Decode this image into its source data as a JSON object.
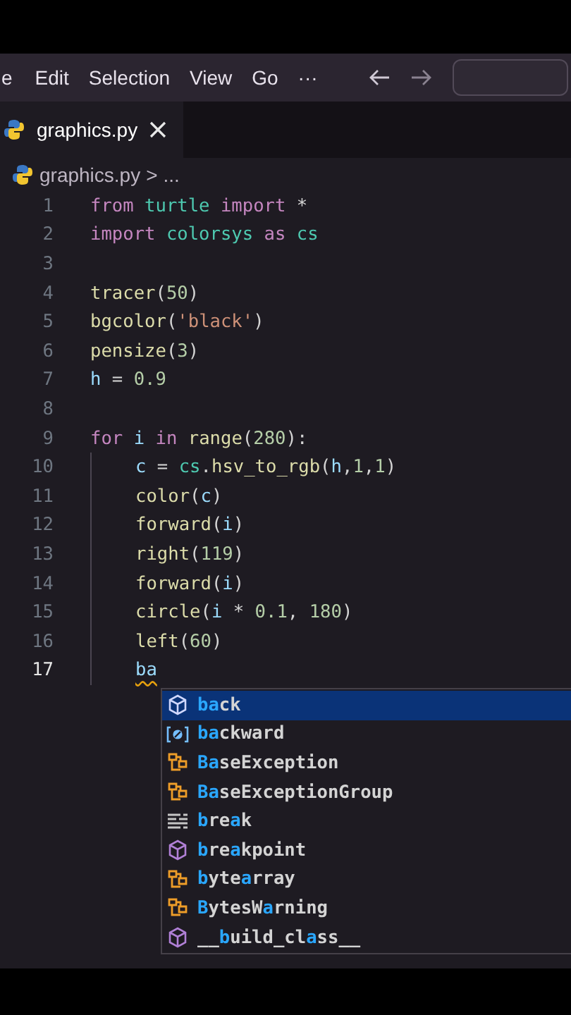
{
  "menu": [
    "e",
    "Edit",
    "Selection",
    "View",
    "Go",
    "···"
  ],
  "tabs": [
    {
      "label": "graphics.py",
      "selected": true
    }
  ],
  "breadcrumb": {
    "file": "graphics.py",
    "separator": ">",
    "rest": "..."
  },
  "code": [
    {
      "number": "1",
      "current": false,
      "indent": false,
      "tokens": [
        {
          "text": "from ",
          "kind": "keyword"
        },
        {
          "text": "turtle ",
          "kind": "module"
        },
        {
          "text": "import ",
          "kind": "keyword"
        },
        {
          "text": "*",
          "kind": "plain"
        }
      ]
    },
    {
      "number": "2",
      "current": false,
      "indent": false,
      "tokens": [
        {
          "text": "import ",
          "kind": "keyword"
        },
        {
          "text": "colorsys ",
          "kind": "module"
        },
        {
          "text": "as ",
          "kind": "keyword"
        },
        {
          "text": "cs",
          "kind": "module"
        }
      ]
    },
    {
      "number": "3",
      "current": false,
      "indent": false
    },
    {
      "number": "4",
      "current": false,
      "indent": false,
      "tokens": [
        {
          "text": "tracer",
          "kind": "func"
        },
        {
          "text": "(",
          "kind": "plain"
        },
        {
          "text": "50",
          "kind": "number"
        },
        {
          "text": ")",
          "kind": "plain"
        }
      ]
    },
    {
      "number": "5",
      "current": false,
      "indent": false,
      "tokens": [
        {
          "text": "bgcolor",
          "kind": "func"
        },
        {
          "text": "(",
          "kind": "plain"
        },
        {
          "text": "'black'",
          "kind": "string"
        },
        {
          "text": ")",
          "kind": "plain"
        }
      ]
    },
    {
      "number": "6",
      "current": false,
      "indent": false,
      "tokens": [
        {
          "text": "pensize",
          "kind": "func"
        },
        {
          "text": "(",
          "kind": "plain"
        },
        {
          "text": "3",
          "kind": "number"
        },
        {
          "text": ")",
          "kind": "plain"
        }
      ]
    },
    {
      "number": "7",
      "current": false,
      "indent": false,
      "tokens": [
        {
          "text": "h",
          "kind": "var"
        },
        {
          "text": " = ",
          "kind": "plain"
        },
        {
          "text": "0.9",
          "kind": "number"
        }
      ]
    },
    {
      "number": "8",
      "current": false,
      "indent": false
    },
    {
      "number": "9",
      "current": false,
      "indent": false,
      "tokens": [
        {
          "text": "for ",
          "kind": "keyword"
        },
        {
          "text": "i ",
          "kind": "var"
        },
        {
          "text": "in ",
          "kind": "keyword"
        },
        {
          "text": "range",
          "kind": "func"
        },
        {
          "text": "(",
          "kind": "plain"
        },
        {
          "text": "280",
          "kind": "number"
        },
        {
          "text": "):",
          "kind": "plain"
        }
      ]
    },
    {
      "number": "10",
      "current": false,
      "indent": true,
      "tokens": [
        {
          "text": "c",
          "kind": "var"
        },
        {
          "text": " = ",
          "kind": "plain"
        },
        {
          "text": "cs",
          "kind": "module"
        },
        {
          "text": ".",
          "kind": "plain"
        },
        {
          "text": "hsv_to_rgb",
          "kind": "func"
        },
        {
          "text": "(",
          "kind": "plain"
        },
        {
          "text": "h",
          "kind": "var"
        },
        {
          "text": ",",
          "kind": "plain"
        },
        {
          "text": "1",
          "kind": "number"
        },
        {
          "text": ",",
          "kind": "plain"
        },
        {
          "text": "1",
          "kind": "number"
        },
        {
          "text": ")",
          "kind": "plain"
        }
      ]
    },
    {
      "number": "11",
      "current": false,
      "indent": true,
      "tokens": [
        {
          "text": "color",
          "kind": "func"
        },
        {
          "text": "(",
          "kind": "plain"
        },
        {
          "text": "c",
          "kind": "var"
        },
        {
          "text": ")",
          "kind": "plain"
        }
      ]
    },
    {
      "number": "12",
      "current": false,
      "indent": true,
      "tokens": [
        {
          "text": "forward",
          "kind": "func"
        },
        {
          "text": "(",
          "kind": "plain"
        },
        {
          "text": "i",
          "kind": "var"
        },
        {
          "text": ")",
          "kind": "plain"
        }
      ]
    },
    {
      "number": "13",
      "current": false,
      "indent": true,
      "tokens": [
        {
          "text": "right",
          "kind": "func"
        },
        {
          "text": "(",
          "kind": "plain"
        },
        {
          "text": "119",
          "kind": "number"
        },
        {
          "text": ")",
          "kind": "plain"
        }
      ]
    },
    {
      "number": "14",
      "current": false,
      "indent": true,
      "tokens": [
        {
          "text": "forward",
          "kind": "func"
        },
        {
          "text": "(",
          "kind": "plain"
        },
        {
          "text": "i",
          "kind": "var"
        },
        {
          "text": ")",
          "kind": "plain"
        }
      ]
    },
    {
      "number": "15",
      "current": false,
      "indent": true,
      "tokens": [
        {
          "text": "circle",
          "kind": "func"
        },
        {
          "text": "(",
          "kind": "plain"
        },
        {
          "text": "i",
          "kind": "var"
        },
        {
          "text": " * ",
          "kind": "plain"
        },
        {
          "text": "0.1",
          "kind": "number"
        },
        {
          "text": ", ",
          "kind": "plain"
        },
        {
          "text": "180",
          "kind": "number"
        },
        {
          "text": ")",
          "kind": "plain"
        }
      ]
    },
    {
      "number": "16",
      "current": false,
      "indent": true,
      "tokens": [
        {
          "text": "left",
          "kind": "func"
        },
        {
          "text": "(",
          "kind": "plain"
        },
        {
          "text": "60",
          "kind": "number"
        },
        {
          "text": ")",
          "kind": "plain"
        }
      ]
    },
    {
      "number": "17",
      "current": true,
      "indent": true,
      "tokens": [
        {
          "text": "ba",
          "kind": "error"
        }
      ]
    }
  ],
  "suggestions": [
    {
      "kind": "method",
      "selected": true,
      "parts": [
        {
          "text": "ba",
          "match": true
        },
        {
          "text": "ck",
          "match": false
        }
      ]
    },
    {
      "kind": "variable",
      "selected": false,
      "parts": [
        {
          "text": "ba",
          "match": true
        },
        {
          "text": "ckward",
          "match": false
        }
      ]
    },
    {
      "kind": "class",
      "selected": false,
      "parts": [
        {
          "text": "Ba",
          "match": true
        },
        {
          "text": "seException",
          "match": false
        }
      ]
    },
    {
      "kind": "class",
      "selected": false,
      "parts": [
        {
          "text": "Ba",
          "match": true
        },
        {
          "text": "seExceptionGroup",
          "match": false
        }
      ]
    },
    {
      "kind": "keyword",
      "selected": false,
      "parts": [
        {
          "text": "b",
          "match": true
        },
        {
          "text": "re",
          "match": false
        },
        {
          "text": "a",
          "match": true
        },
        {
          "text": "k",
          "match": false
        }
      ]
    },
    {
      "kind": "function",
      "selected": false,
      "parts": [
        {
          "text": "b",
          "match": true
        },
        {
          "text": "re",
          "match": false
        },
        {
          "text": "a",
          "match": true
        },
        {
          "text": "kpoint",
          "match": false
        }
      ]
    },
    {
      "kind": "class",
      "selected": false,
      "parts": [
        {
          "text": "b",
          "match": true
        },
        {
          "text": "yte",
          "match": false
        },
        {
          "text": "a",
          "match": true
        },
        {
          "text": "rray",
          "match": false
        }
      ]
    },
    {
      "kind": "class",
      "selected": false,
      "parts": [
        {
          "text": "B",
          "match": true
        },
        {
          "text": "ytesW",
          "match": false
        },
        {
          "text": "a",
          "match": true
        },
        {
          "text": "rning",
          "match": false
        }
      ]
    },
    {
      "kind": "function",
      "selected": false,
      "parts": [
        {
          "text": "__",
          "match": false
        },
        {
          "text": "b",
          "match": true
        },
        {
          "text": "uild_cl",
          "match": false
        },
        {
          "text": "a",
          "match": true
        },
        {
          "text": "ss__",
          "match": false
        }
      ]
    }
  ]
}
